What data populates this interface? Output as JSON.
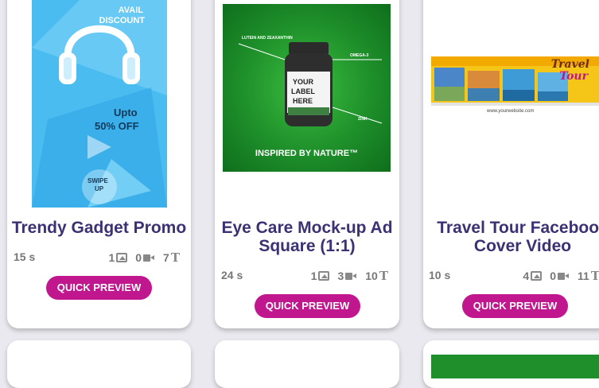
{
  "cards": [
    {
      "title": "Trendy Gadget Promo",
      "duration": "15 s",
      "images": "1",
      "videos": "0",
      "texts": "7",
      "button": "QUICK PREVIEW",
      "thumb_text": {
        "line1": "AVAIL",
        "line2": "DISCOUNT",
        "upto": "Upto",
        "off": "50% OFF",
        "swipe1": "SWIPE",
        "swipe2": "UP"
      }
    },
    {
      "title_line1": "Eye Care Mock-up Ad",
      "title_line2": "Square (1:1)",
      "duration": "24 s",
      "images": "1",
      "videos": "3",
      "texts": "10",
      "button": "QUICK PREVIEW",
      "thumb_text": {
        "label1": "YOUR",
        "label2": "LABEL",
        "label3": "HERE",
        "tag": "INSPIRED BY NATURE™",
        "c1": "LUTEIN AND ZEAXANTHIN",
        "c2": "OMEGA-3",
        "c3": "ZINK"
      }
    },
    {
      "title_line1": "Travel Tour Facebook",
      "title_line2": "Cover Video",
      "duration": "10 s",
      "images": "4",
      "videos": "0",
      "texts": "11",
      "button": "QUICK PREVIEW",
      "thumb_text": {
        "brand1": "Travel",
        "brand2": "Tour",
        "site": "www.yourwebsite.com"
      }
    }
  ],
  "colors": {
    "accent": "#c0168e",
    "title": "#3a3273",
    "green": "#1e8f2a",
    "blue": "#45b7ee"
  }
}
